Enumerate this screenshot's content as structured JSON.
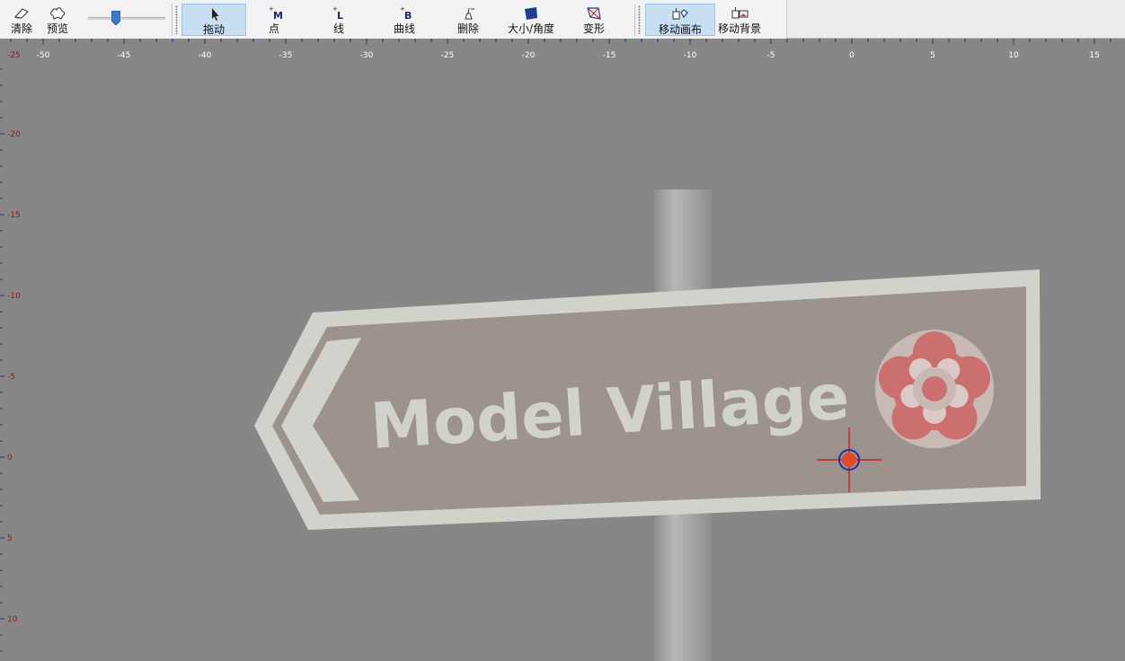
{
  "toolbar": {
    "buttons": [
      {
        "label": "清除",
        "icon": "eraser-icon"
      },
      {
        "label": "预览",
        "icon": "puzzle-icon"
      },
      {
        "label": "拖动",
        "icon": "cursor-icon",
        "active": true
      },
      {
        "label": "点",
        "icon": "add-point-icon"
      },
      {
        "label": "线",
        "icon": "add-line-icon"
      },
      {
        "label": "曲线",
        "icon": "add-curve-icon"
      },
      {
        "label": "删除",
        "icon": "delete-point-icon"
      },
      {
        "label": "大小/角度",
        "icon": "resize-rotate-icon"
      },
      {
        "label": "变形",
        "icon": "warp-icon"
      },
      {
        "label": "移动画布",
        "icon": "move-canvas-icon",
        "active": true
      },
      {
        "label": "移动背景",
        "icon": "move-background-icon"
      }
    ],
    "glyphs": {
      "point": "M",
      "line": "L",
      "curve": "B"
    },
    "zoom_slider": {
      "value": 0.33
    }
  },
  "rulers": {
    "horizontal_labels": [
      "-50",
      "-45",
      "-40",
      "-35",
      "-30",
      "-25",
      "-20",
      "-15",
      "-10",
      "-5",
      "0",
      "5",
      "10",
      "15"
    ],
    "vertical_labels": [
      "-25",
      "-20",
      "-15",
      "-10",
      "-5",
      "0",
      "5",
      "10"
    ]
  },
  "background": {
    "sign_text": "Model Village",
    "emblem": "rose-emblem"
  },
  "colors": {
    "toolbar_bg": "#f2f2f2",
    "active_button": "#c7def3",
    "ruler_text": "#ffffff",
    "ruler_tick": "#2e2e8c",
    "vertical_ruler_text": "#8a1a1a",
    "canvas_bg": "#878787",
    "sign_panel": "#9c948c",
    "sign_border": "#d2d2cc",
    "rose_red": "#cb6f6f",
    "control_point_fill": "#e04a2a",
    "control_point_ring": "#2a2a9c",
    "crosshair": "#cc1f1f"
  }
}
